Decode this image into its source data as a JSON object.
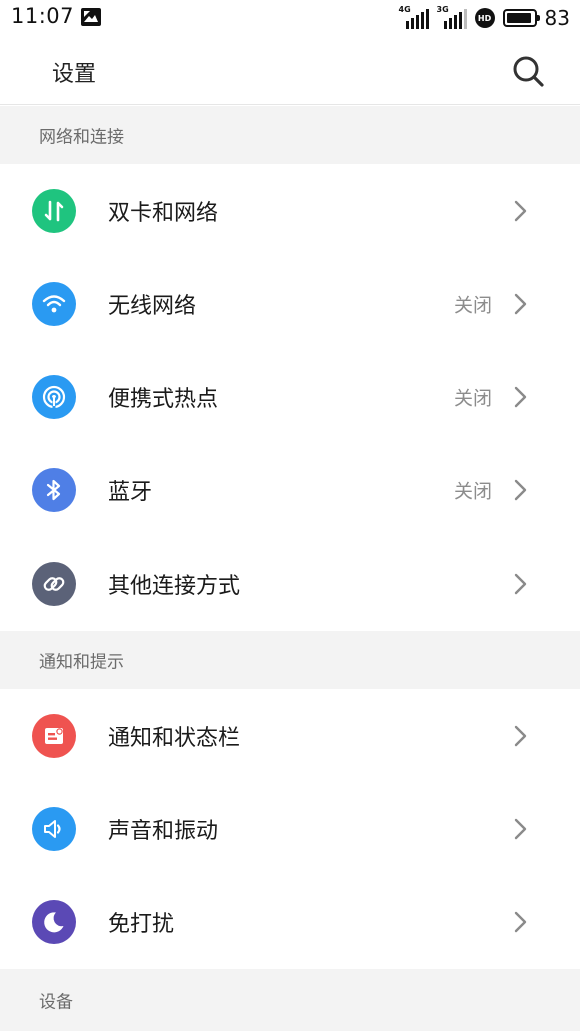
{
  "status_bar": {
    "time": "11:07",
    "signal1_tag": "4G",
    "signal2_tag": "3G",
    "hd_badge": "HD",
    "battery_level": 83,
    "battery_text": "83"
  },
  "header": {
    "title": "设置",
    "search_icon": "search-icon"
  },
  "sections": {
    "network": {
      "title": "网络和连接",
      "items": [
        {
          "label": "双卡和网络",
          "value": "",
          "icon": "dual-sim-icon",
          "color": "#1fc47f"
        },
        {
          "label": "无线网络",
          "value": "关闭",
          "icon": "wifi-icon",
          "color": "#2a9af2"
        },
        {
          "label": "便携式热点",
          "value": "关闭",
          "icon": "hotspot-icon",
          "color": "#2a9af2"
        },
        {
          "label": "蓝牙",
          "value": "关闭",
          "icon": "bluetooth-icon",
          "color": "#4f7fe6"
        },
        {
          "label": "其他连接方式",
          "value": "",
          "icon": "link-icon",
          "color": "#5b6278"
        }
      ]
    },
    "notifications": {
      "title": "通知和提示",
      "items": [
        {
          "label": "通知和状态栏",
          "value": "",
          "icon": "notification-icon",
          "color": "#ef5350"
        },
        {
          "label": "声音和振动",
          "value": "",
          "icon": "speaker-icon",
          "color": "#2a9af2"
        },
        {
          "label": "免打扰",
          "value": "",
          "icon": "moon-icon",
          "color": "#5b49b5"
        }
      ]
    },
    "device": {
      "title": "设备"
    }
  }
}
